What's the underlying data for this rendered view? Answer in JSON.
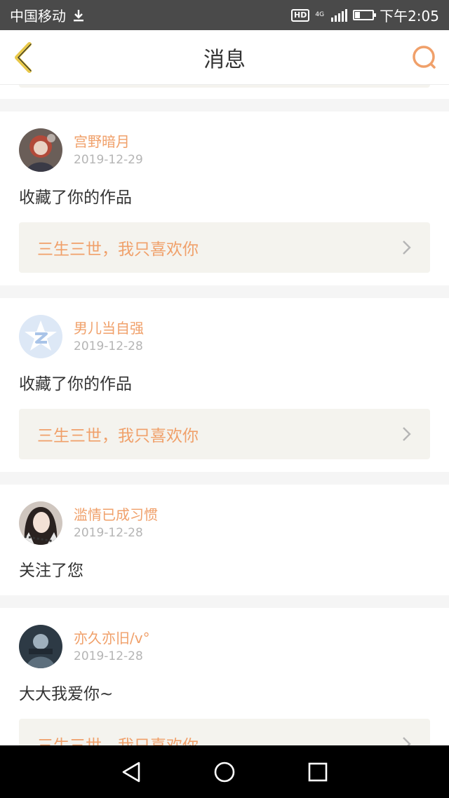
{
  "status_bar": {
    "carrier": "中国移动",
    "hd": "HD",
    "network": "4G",
    "time": "下午2:05",
    "battery_level": 0.3
  },
  "header": {
    "title": "消息",
    "back_icon": "chevron-left-icon",
    "search_icon": "search-icon"
  },
  "messages": [
    {
      "username": "宫野暗月",
      "date": "2019-12-29",
      "action": "收藏了你的作品",
      "work_title": "三生三世，我只喜欢你"
    },
    {
      "username": "男儿当自强",
      "date": "2019-12-28",
      "action": "收藏了你的作品",
      "work_title": "三生三世，我只喜欢你"
    },
    {
      "username": "滥情已成习惯",
      "date": "2019-12-28",
      "action": "关注了您"
    },
    {
      "username": "亦久亦旧/v°",
      "date": "2019-12-28",
      "action": "大大我爱你~",
      "work_title": "三生三世，我只喜欢你"
    }
  ],
  "colors": {
    "accent": "#f0a06a",
    "back_icon": "#e8c84a",
    "link_bg": "#f4f3ee"
  }
}
